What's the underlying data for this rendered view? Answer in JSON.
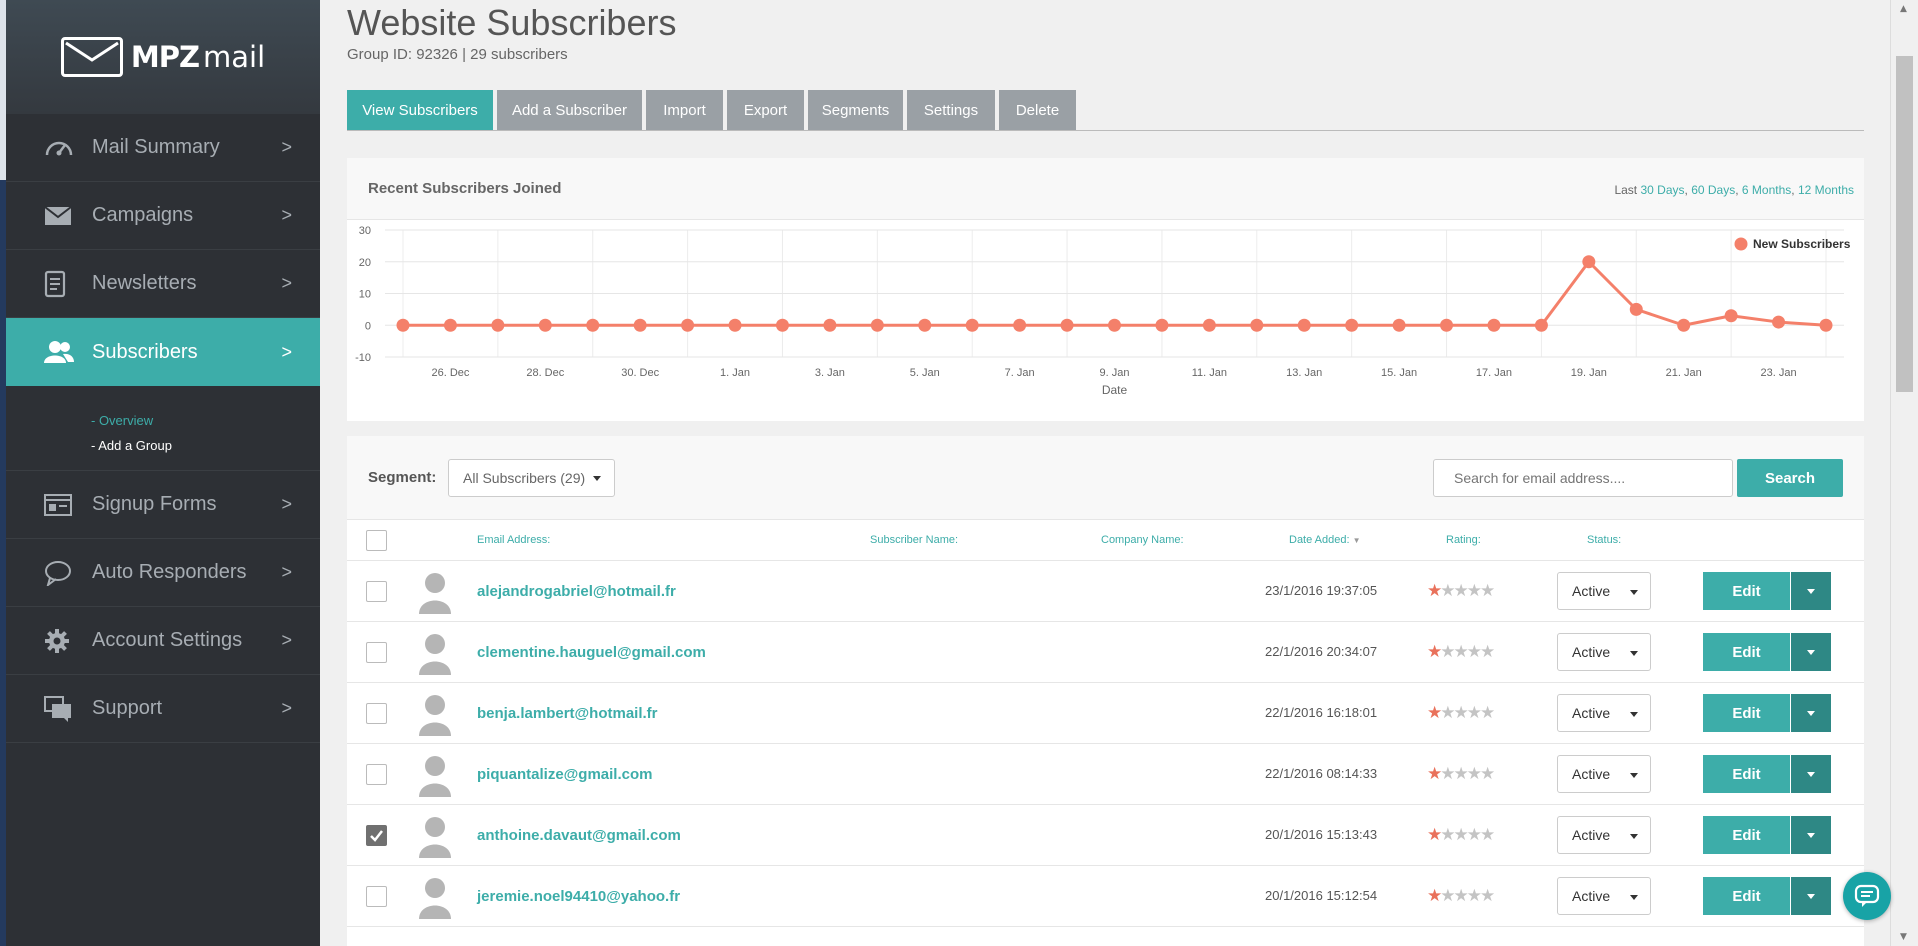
{
  "app": {
    "logo_bold": "MPZ",
    "logo_light": "mail"
  },
  "sidebar": {
    "items": [
      {
        "label": "Mail Summary",
        "icon": "speedometer-icon",
        "arrow": ">"
      },
      {
        "label": "Campaigns",
        "icon": "envelope-icon",
        "arrow": ">"
      },
      {
        "label": "Newsletters",
        "icon": "document-icon",
        "arrow": ">"
      },
      {
        "label": "Subscribers",
        "icon": "users-icon",
        "arrow": ">",
        "active": true
      },
      {
        "label": "Signup Forms",
        "icon": "form-icon",
        "arrow": ">"
      },
      {
        "label": "Auto Responders",
        "icon": "speech-bubble-icon",
        "arrow": ">"
      },
      {
        "label": "Account Settings",
        "icon": "gear-icon",
        "arrow": ">"
      },
      {
        "label": "Support",
        "icon": "chat-icon",
        "arrow": ">"
      }
    ],
    "subnav": {
      "overview": "- Overview",
      "add_group": "- Add a Group"
    }
  },
  "header": {
    "title": "Website Subscribers",
    "group_info": "Group ID: 92326 | 29 subscribers"
  },
  "tabs": [
    {
      "label": "View Subscribers",
      "active": true
    },
    {
      "label": "Add a Subscriber"
    },
    {
      "label": "Import"
    },
    {
      "label": "Export"
    },
    {
      "label": "Segments"
    },
    {
      "label": "Settings"
    },
    {
      "label": "Delete"
    }
  ],
  "chart_panel": {
    "title": "Recent Subscribers Joined",
    "range_prefix": "Last",
    "range_links": [
      "30 Days",
      "60 Days",
      "6 Months",
      "12 Months"
    ],
    "range_sep": ","
  },
  "chart_data": {
    "type": "line",
    "title": "",
    "xlabel": "Date",
    "ylabel": "",
    "ylim": [
      -10,
      30
    ],
    "yticks": [
      -10,
      0,
      10,
      20,
      30
    ],
    "xtick_labels": [
      "26. Dec",
      "28. Dec",
      "30. Dec",
      "1. Jan",
      "3. Jan",
      "5. Jan",
      "7. Jan",
      "9. Jan",
      "11. Jan",
      "13. Jan",
      "15. Jan",
      "17. Jan",
      "19. Jan",
      "21. Jan",
      "23. Jan"
    ],
    "x": [
      "25. Dec",
      "26. Dec",
      "27. Dec",
      "28. Dec",
      "29. Dec",
      "30. Dec",
      "31. Dec",
      "1. Jan",
      "2. Jan",
      "3. Jan",
      "4. Jan",
      "5. Jan",
      "6. Jan",
      "7. Jan",
      "8. Jan",
      "9. Jan",
      "10. Jan",
      "11. Jan",
      "12. Jan",
      "13. Jan",
      "14. Jan",
      "15. Jan",
      "16. Jan",
      "17. Jan",
      "18. Jan",
      "19. Jan",
      "20. Jan",
      "21. Jan",
      "22. Jan",
      "23. Jan",
      "24. Jan"
    ],
    "series": [
      {
        "name": "New Subscribers",
        "color": "#f4806a",
        "values": [
          0,
          0,
          0,
          0,
          0,
          0,
          0,
          0,
          0,
          0,
          0,
          0,
          0,
          0,
          0,
          0,
          0,
          0,
          0,
          0,
          0,
          0,
          0,
          0,
          0,
          20,
          5,
          0,
          3,
          1,
          0
        ]
      }
    ],
    "legend": "top-right",
    "grid": true
  },
  "toolbar": {
    "segment_label": "Segment:",
    "segment_value": "All Subscribers (29)",
    "search_placeholder": "Search for email address....",
    "search_button": "Search"
  },
  "table": {
    "columns": {
      "email": "Email Address:",
      "name": "Subscriber Name:",
      "company": "Company Name:",
      "date": "Date Added:",
      "rating": "Rating:",
      "status": "Status:"
    },
    "rows": [
      {
        "email": "alejandrogabriel@hotmail.fr",
        "date": "23/1/2016 19:37:05",
        "rating": 1,
        "status": "Active",
        "checked": false
      },
      {
        "email": "clementine.hauguel@gmail.com",
        "date": "22/1/2016 20:34:07",
        "rating": 1,
        "status": "Active",
        "checked": false
      },
      {
        "email": "benja.lambert@hotmail.fr",
        "date": "22/1/2016 16:18:01",
        "rating": 1,
        "status": "Active",
        "checked": false
      },
      {
        "email": "piquantalize@gmail.com",
        "date": "22/1/2016 08:14:33",
        "rating": 1,
        "status": "Active",
        "checked": false
      },
      {
        "email": "anthoine.davaut@gmail.com",
        "date": "20/1/2016 15:13:43",
        "rating": 1,
        "status": "Active",
        "checked": true
      },
      {
        "email": "jeremie.noel94410@yahoo.fr",
        "date": "20/1/2016 15:12:54",
        "rating": 1,
        "status": "Active",
        "checked": false
      }
    ],
    "edit_label": "Edit"
  },
  "colors": {
    "accent": "#3dada9",
    "sidebar_bg": "#2d3035",
    "chart_line": "#f4806a",
    "star": "#e9715b"
  }
}
